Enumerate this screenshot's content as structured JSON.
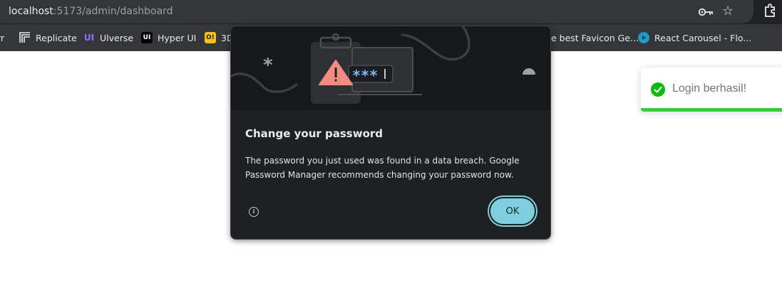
{
  "browser": {
    "url_host": "localhost",
    "url_path": ":5173/admin/dashboard"
  },
  "bookmarks": [
    {
      "label": "rr",
      "icon": "truncated-bookmark"
    },
    {
      "label": "Replicate",
      "icon": "replicate-icon",
      "icon_text": ""
    },
    {
      "label": "Ulverse",
      "icon": "uiverse-icon",
      "icon_text": "UI"
    },
    {
      "label": "Hyper UI",
      "icon": "hyperui-icon",
      "icon_text": "UI"
    },
    {
      "label": "3D",
      "icon": "3d-icon",
      "icon_text": "O!"
    },
    {
      "label": "e best Favicon Ge...",
      "icon": "none"
    },
    {
      "label": "React Carousel - Flo...",
      "icon": "react-carousel-icon"
    }
  ],
  "toast": {
    "message": "Login berhasil!",
    "status_color": "#07bc0c",
    "progress": 1.0
  },
  "dialog": {
    "title": "Change your password",
    "body": "The password you just used was found in a data breach. Google Password Manager recommends changing your password now.",
    "ok_label": "OK",
    "illustration_text": "***",
    "accent_color": "#7fcfdf"
  }
}
